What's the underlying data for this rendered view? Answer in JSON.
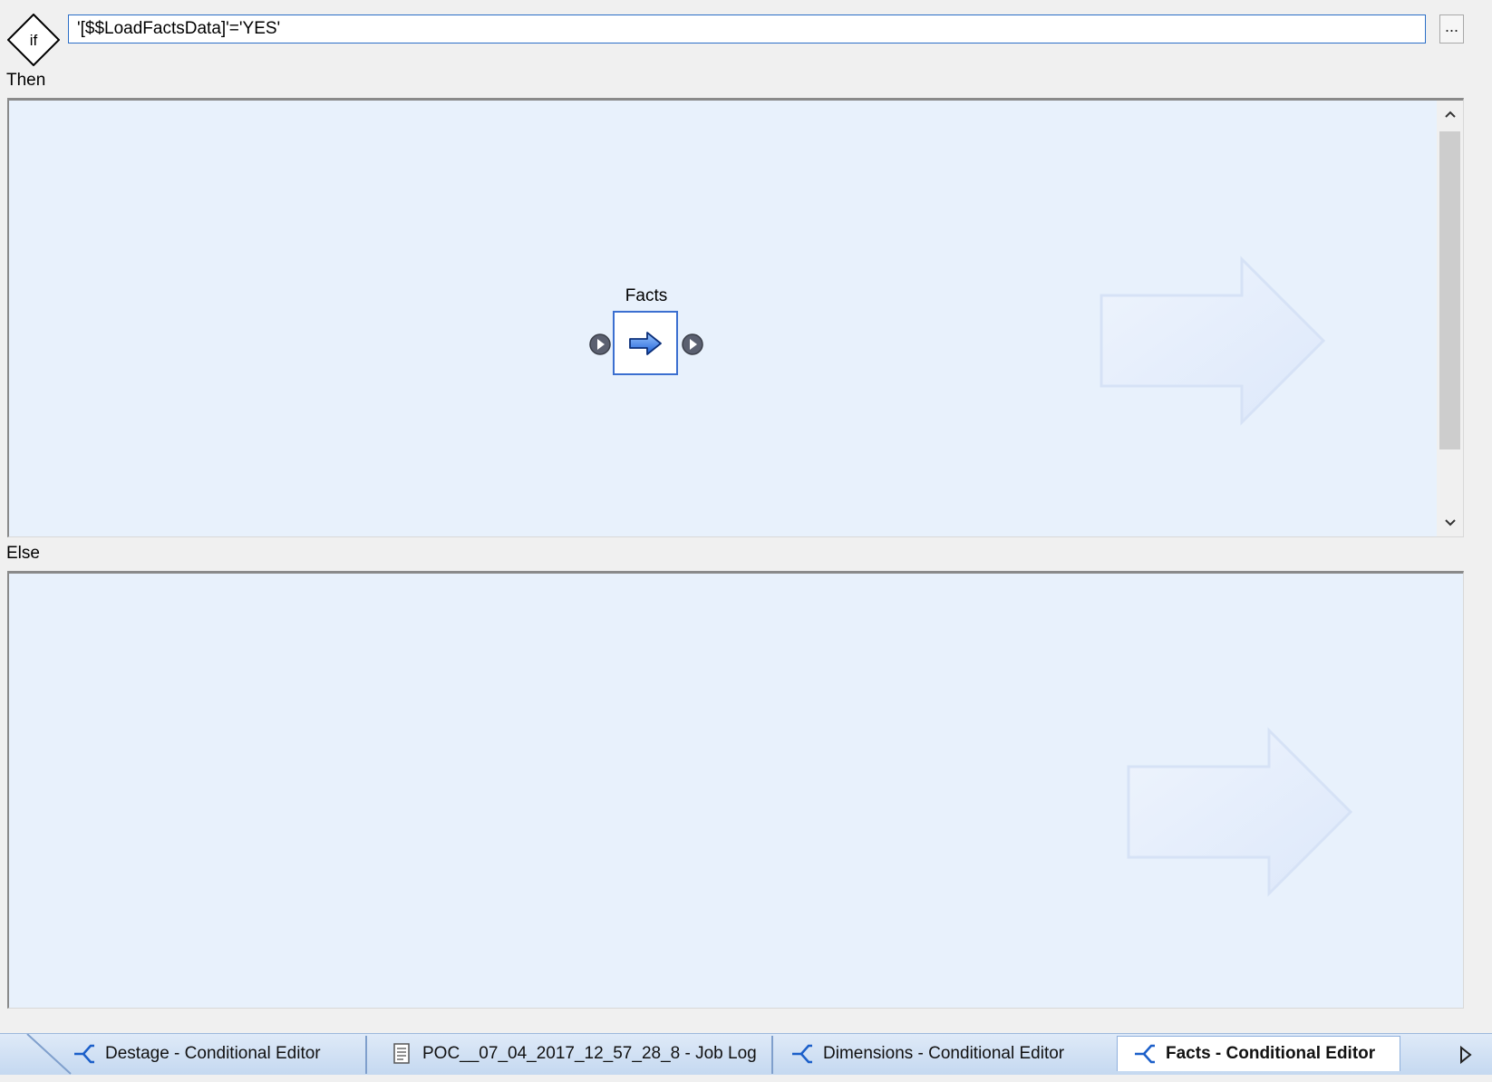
{
  "condition": {
    "keyword": "if",
    "expression": "'[$$LoadFactsData]'='YES'",
    "browse_label": "..."
  },
  "then_section": {
    "label": "Then",
    "task": {
      "name": "Facts",
      "icon": "blue-arrow-icon"
    }
  },
  "else_section": {
    "label": "Else"
  },
  "tabs": [
    {
      "label": "Destage - Conditional Editor",
      "icon": "conditional-icon",
      "active": false
    },
    {
      "label": "POC__07_04_2017_12_57_28_8 - Job Log",
      "icon": "document-icon",
      "active": false
    },
    {
      "label": "Dimensions - Conditional Editor",
      "icon": "conditional-icon",
      "active": false
    },
    {
      "label": "Facts - Conditional Editor",
      "icon": "conditional-icon",
      "active": true
    }
  ],
  "colors": {
    "canvas_bg": "#e8f1fc",
    "input_border": "#2b6ec7",
    "node_border": "#3b6fd0",
    "tabstrip_bg": "#c4d8f0"
  }
}
